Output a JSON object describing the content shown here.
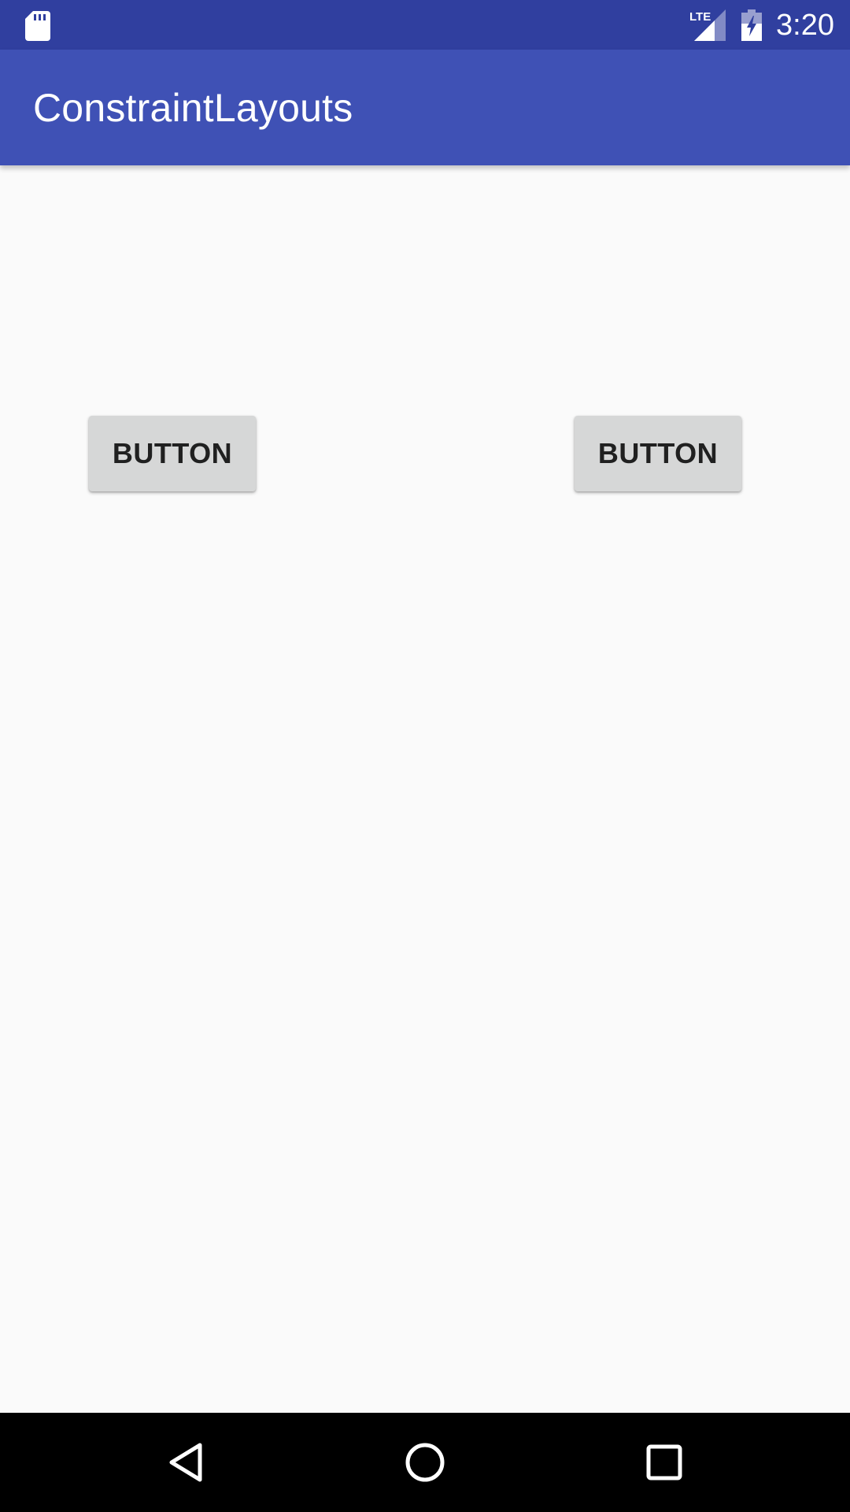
{
  "status_bar": {
    "time": "3:20",
    "network_label": "LTE",
    "icons": [
      "sd-card-icon",
      "lte-signal-icon",
      "battery-charging-icon"
    ]
  },
  "app_bar": {
    "title": "ConstraintLayouts"
  },
  "buttons": {
    "left_label": "BUTTON",
    "right_label": "BUTTON"
  },
  "nav_bar": {
    "icons": [
      "back-icon",
      "home-icon",
      "recents-icon"
    ]
  },
  "colors": {
    "status_bar": "#303f9f",
    "app_bar": "#3f51b5",
    "background": "#fafafa",
    "button": "#d6d7d7",
    "nav_bar": "#000000"
  }
}
